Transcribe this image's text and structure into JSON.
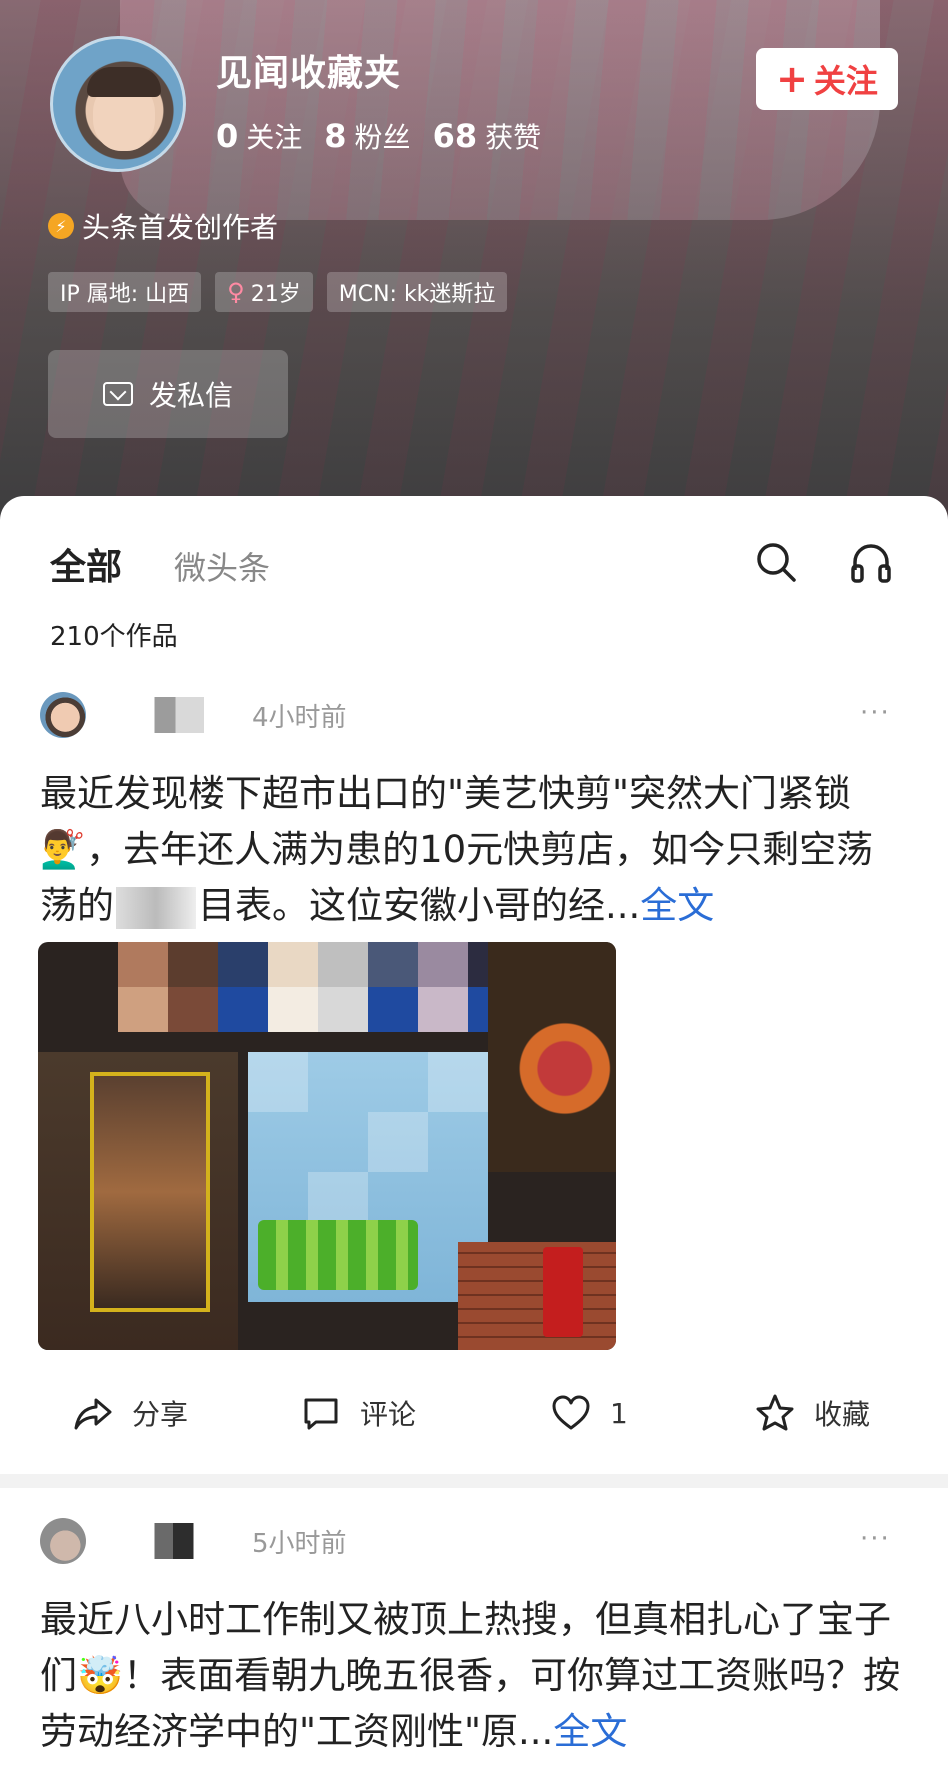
{
  "profile": {
    "name": "见闻收藏夹",
    "stats": [
      {
        "num": "0",
        "label": "关注"
      },
      {
        "num": "8",
        "label": "粉丝"
      },
      {
        "num": "68",
        "label": "获赞"
      }
    ],
    "follow_label": "关注",
    "creator_badge": "头条首发创作者",
    "tags": {
      "ip": "IP 属地: 山西",
      "age": "21岁",
      "mcn": "MCN: kk迷斯拉"
    },
    "message_label": "发私信"
  },
  "tabs": {
    "all": "全部",
    "micro": "微头条"
  },
  "works_count": "210个作品",
  "posts": [
    {
      "time": "4小时前",
      "text_a": "最近发现楼下超市出口的\"美艺快剪\"突然大门紧锁💇‍♂️，去年还人满为患的10元快剪店，如今只剩空荡荡的",
      "text_b": "目表。这位安徽小哥的经...",
      "full_label": "全文",
      "actions": {
        "share": "分享",
        "comment": "评论",
        "like_count": "1",
        "collect": "收藏"
      }
    },
    {
      "time": "5小时前",
      "text": "最近八小时工作制又被顶上热搜，但真相扎心了宝子们🤯！表面看朝九晚五很香，可你算过工资账吗？按劳动经济学中的\"工资刚性\"原...",
      "full_label": "全文"
    }
  ]
}
